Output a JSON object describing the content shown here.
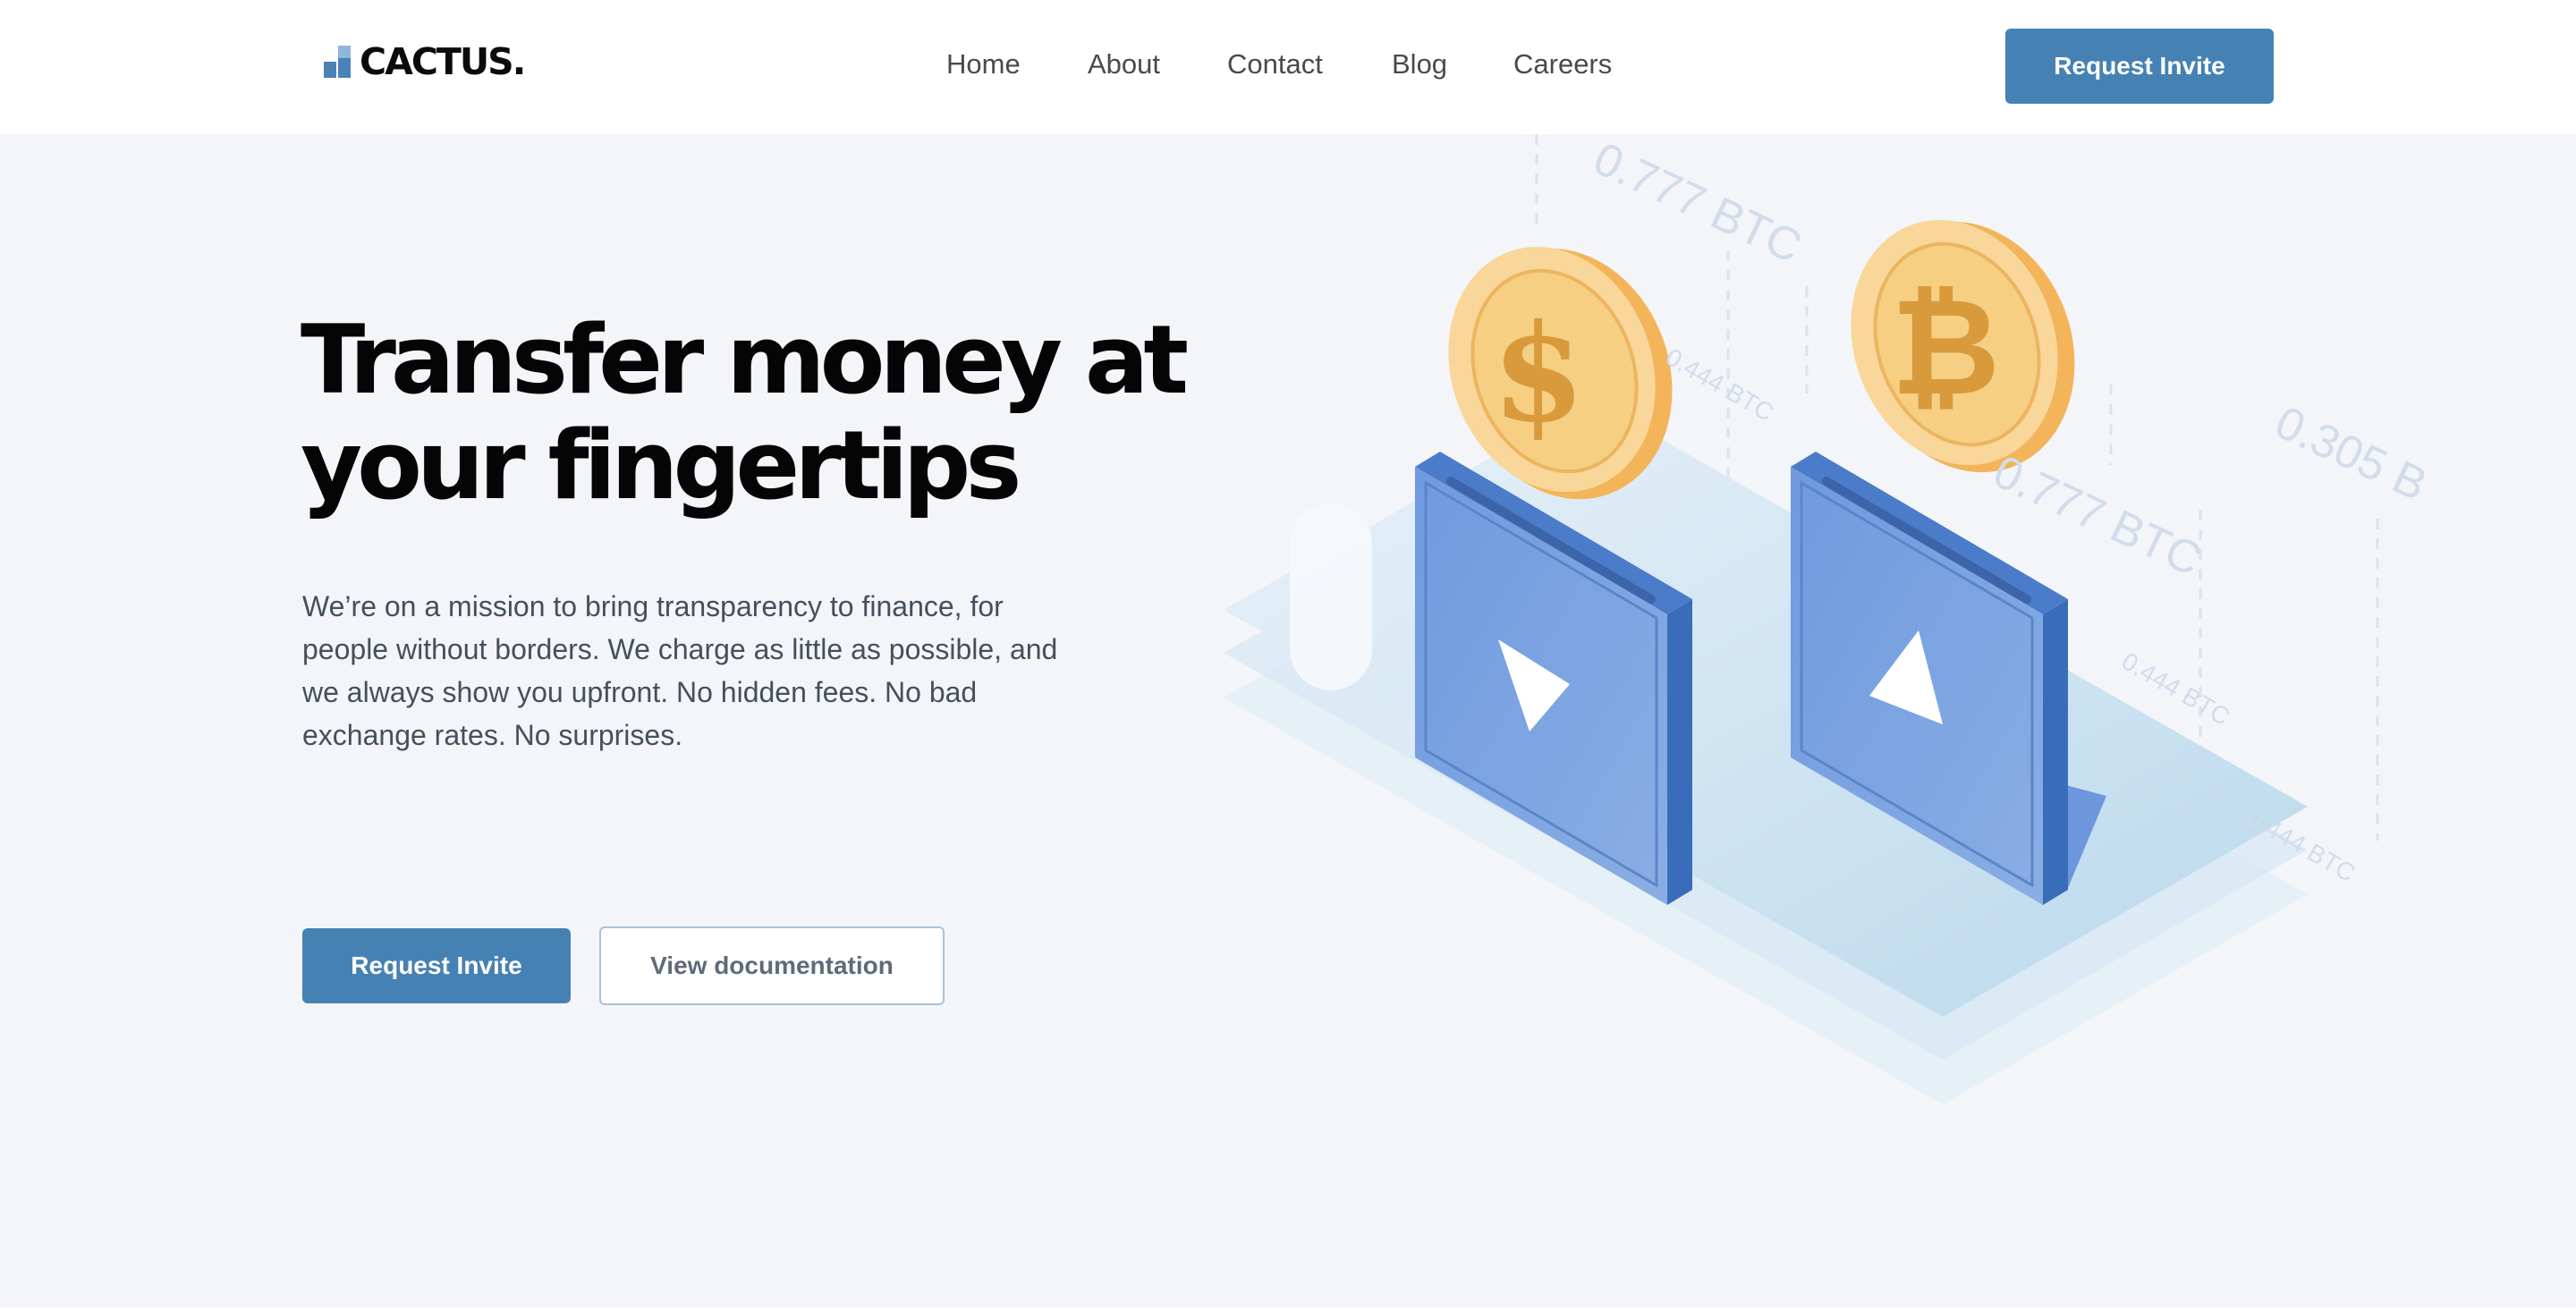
{
  "brand": {
    "name": "CACTUS."
  },
  "nav": {
    "items": [
      {
        "label": "Home"
      },
      {
        "label": "About"
      },
      {
        "label": "Contact"
      },
      {
        "label": "Blog"
      },
      {
        "label": "Careers"
      }
    ],
    "cta_label": "Request Invite"
  },
  "hero": {
    "headline_line1": "Transfer money at",
    "headline_line2": "your fingertips",
    "description": "We’re on a mission to bring transparency to finance, for people without borders. We charge as little as possible, and we always show you upfront. No hidden fees. No bad exchange rates. No surprises.",
    "primary_button": "Request Invite",
    "secondary_button": "View documentation"
  },
  "illustration": {
    "coin_left_symbol": "$",
    "coin_right_symbol": "₿",
    "labels": [
      "0.777 BTC",
      "0.444 BTC",
      "0.777 BTC",
      "0.444 BTC",
      "0.444 BTC",
      "0.305 B"
    ]
  },
  "colors": {
    "accent": "#4681b4",
    "hero_background": "#f3f5f9",
    "coin": "#f6c36a",
    "device": "#5b8fd9"
  }
}
